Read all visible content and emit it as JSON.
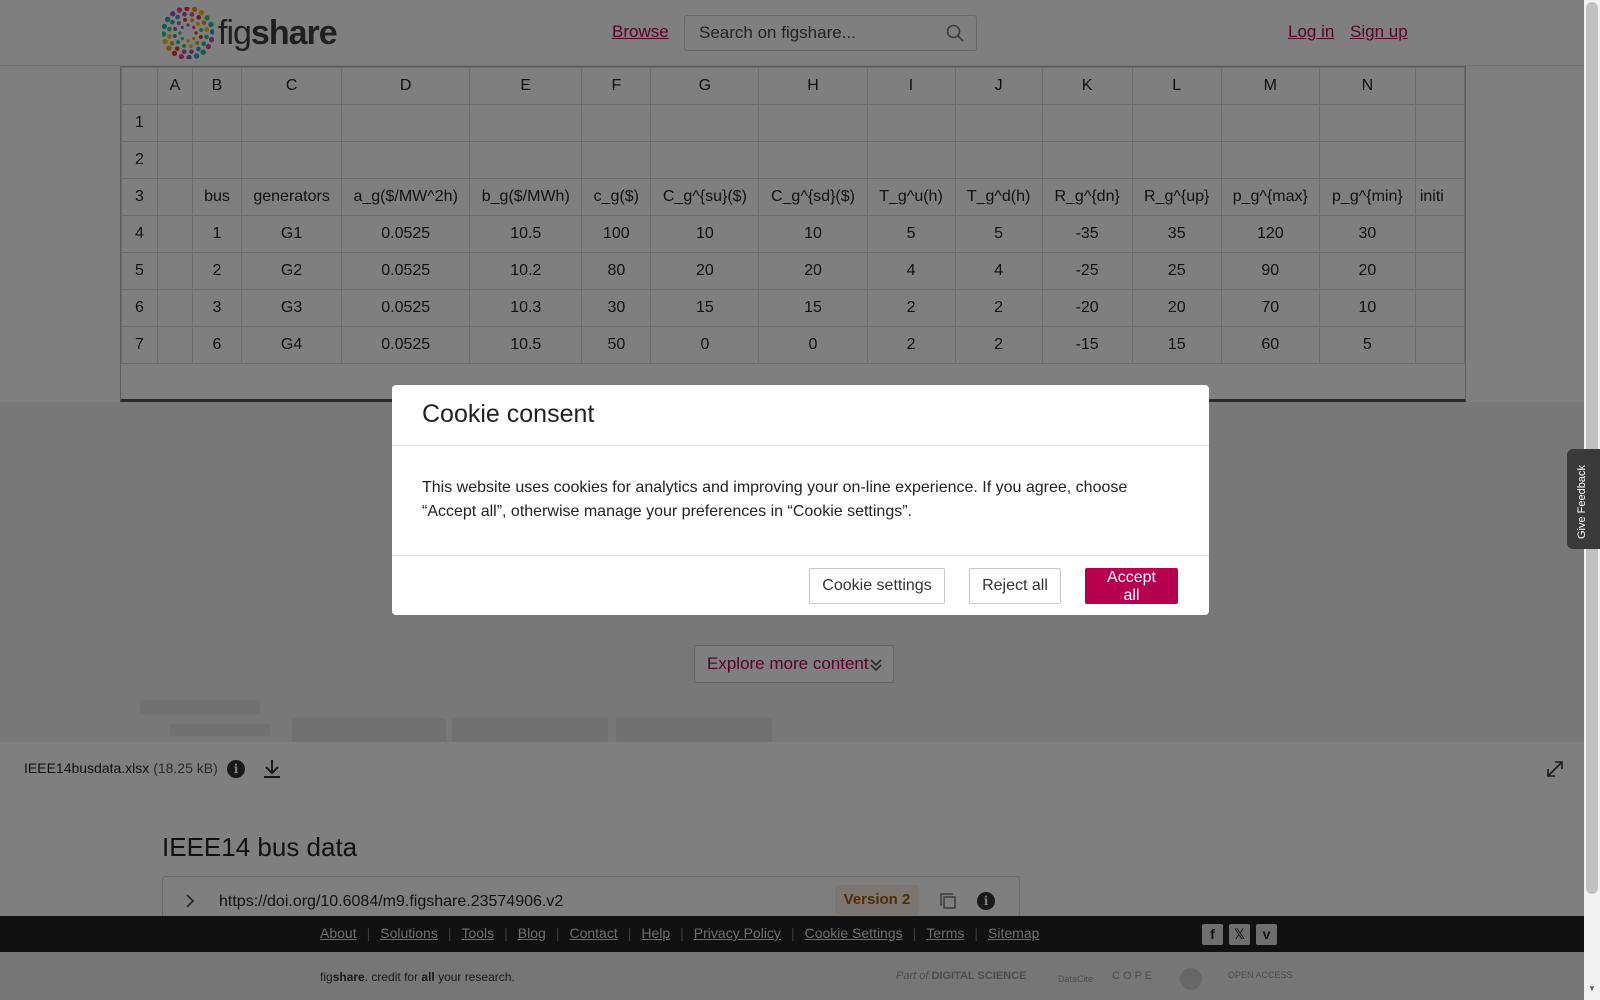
{
  "header": {
    "logo_text_light": "fig",
    "logo_text_bold": "share",
    "browse_label": "Browse",
    "search_placeholder": "Search on figshare...",
    "login_label": "Log in",
    "signup_label": "Sign up"
  },
  "spreadsheet": {
    "column_headers": [
      "",
      "A",
      "B",
      "C",
      "D",
      "E",
      "F",
      "G",
      "H",
      "I",
      "J",
      "K",
      "L",
      "M",
      "N",
      ""
    ],
    "rows": [
      [
        "1",
        "",
        "",
        "",
        "",
        "",
        "",
        "",
        "",
        "",
        "",
        "",
        "",
        "",
        "",
        ""
      ],
      [
        "2",
        "",
        "",
        "",
        "",
        "",
        "",
        "",
        "",
        "",
        "",
        "",
        "",
        "",
        "",
        ""
      ],
      [
        "3",
        "",
        "bus",
        "generators",
        "a_g($/MW^2h)",
        "b_g($/MWh)",
        "c_g($)",
        "C_g^{su}($)",
        "C_g^{sd}($)",
        "T_g^u(h)",
        "T_g^d(h)",
        "R_g^{dn}",
        "R_g^{up}",
        "p_g^{max}",
        "p_g^{min}",
        "initi"
      ],
      [
        "4",
        "",
        "1",
        "G1",
        "0.0525",
        "10.5",
        "100",
        "10",
        "10",
        "5",
        "5",
        "-35",
        "35",
        "120",
        "30",
        ""
      ],
      [
        "5",
        "",
        "2",
        "G2",
        "0.0525",
        "10.2",
        "80",
        "20",
        "20",
        "4",
        "4",
        "-25",
        "25",
        "90",
        "20",
        ""
      ],
      [
        "6",
        "",
        "3",
        "G3",
        "0.0525",
        "10.3",
        "30",
        "15",
        "15",
        "2",
        "2",
        "-20",
        "20",
        "70",
        "10",
        ""
      ],
      [
        "7",
        "",
        "6",
        "G4",
        "0.0525",
        "10.5",
        "50",
        "0",
        "0",
        "2",
        "2",
        "-15",
        "15",
        "60",
        "5",
        ""
      ]
    ]
  },
  "explore_label": "Explore more content",
  "file": {
    "name": "IEEE14busdata.xlsx",
    "size": "(18.25 kB)"
  },
  "item": {
    "title": "IEEE14 bus data",
    "doi": "https://doi.org/10.6084/m9.figshare.23574906.v2",
    "version": "Version 2"
  },
  "footer": {
    "links": [
      "About",
      "Solutions",
      "Tools",
      "Blog",
      "Contact",
      "Help",
      "Privacy Policy",
      "Cookie Settings",
      "Terms",
      "Sitemap"
    ],
    "tagline_fig": "fig",
    "tagline_share": "share",
    "tagline_mid": ". credit for ",
    "tagline_all": "all",
    "tagline_end": " your research.",
    "partner_part_of": "Part of",
    "partner_digital_science": "DIGITAL SCIENCE",
    "partner_datacite": "DataCite",
    "partner_cope": "C O P E",
    "partner_open_access": "OPEN ACCESS"
  },
  "feedback_label": "Give Feedback",
  "cookie_modal": {
    "title": "Cookie consent",
    "body": "This website uses cookies for analytics and improving your on-line experience. If you agree, choose “Accept all”, otherwise manage your preferences in “Cookie settings”.",
    "settings_label": "Cookie settings",
    "reject_label": "Reject all",
    "accept_label": "Accept all"
  },
  "colors": {
    "brand": "#b6004f",
    "version_badge_text": "#a2560b",
    "version_badge_bg": "#f7ede2"
  }
}
